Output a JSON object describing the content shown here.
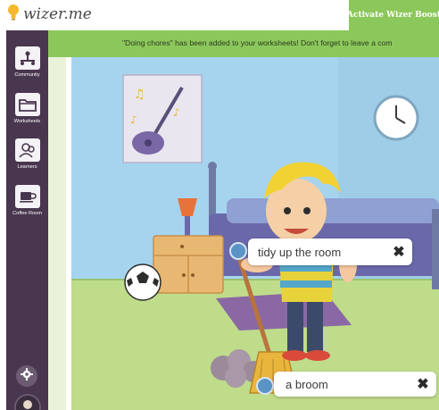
{
  "app": {
    "logo_text": "wizer.me",
    "activate_label": "Activate Wizer Boost"
  },
  "sidebar": {
    "items": [
      {
        "label": "Community",
        "icon": "community-icon"
      },
      {
        "label": "Worksheets",
        "icon": "folder-icon"
      },
      {
        "label": "Learners",
        "icon": "learners-icon"
      },
      {
        "label": "Coffee Room",
        "icon": "coffee-cup-icon"
      }
    ],
    "settings_icon": "gear-icon",
    "avatar_icon": "avatar"
  },
  "banner": {
    "text": "\"Doing chores\" has been added to your worksheets! Don't forget to leave a com"
  },
  "worksheet": {
    "answers": [
      {
        "text": "tidy up the room"
      },
      {
        "text": "a broom"
      }
    ],
    "close_symbol": "✖"
  },
  "colors": {
    "sidebar": "#49364f",
    "accent_green": "#8cc75b",
    "wall": "#a6d4ee",
    "floor": "#bfdc8a"
  }
}
